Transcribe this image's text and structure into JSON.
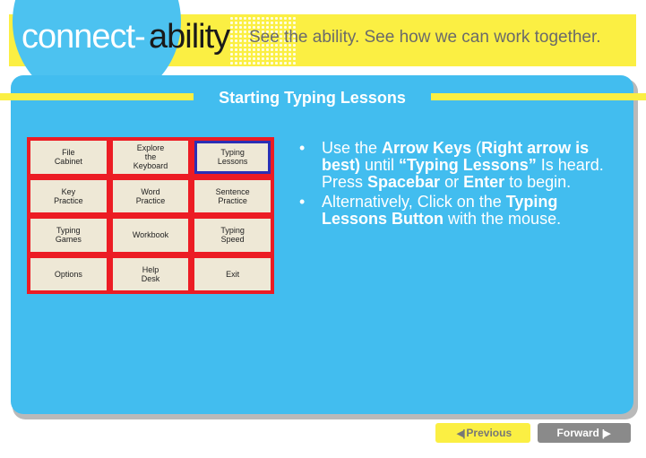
{
  "header": {
    "brand_part1": "connect-",
    "brand_part2": "ability",
    "tagline": "See the ability. See how we can work together."
  },
  "slide": {
    "title": "Starting Typing Lessons"
  },
  "menu": {
    "selected_index": 2,
    "items": [
      {
        "label": "File\nCabinet"
      },
      {
        "label": "Explore\nthe\nKeyboard"
      },
      {
        "label": "Typing\nLessons"
      },
      {
        "label": "Key\nPractice"
      },
      {
        "label": "Word\nPractice"
      },
      {
        "label": "Sentence\nPractice"
      },
      {
        "label": "Typing\nGames"
      },
      {
        "label": "Workbook"
      },
      {
        "label": "Typing\nSpeed"
      },
      {
        "label": "Options"
      },
      {
        "label": "Help\nDesk"
      },
      {
        "label": "Exit"
      }
    ]
  },
  "instructions": {
    "bullet": "•",
    "b1": {
      "t1": "Use the ",
      "t2": "Arrow Keys",
      "t3": " (",
      "t4": "Right arrow is best)",
      "t5": " until ",
      "t6": "“Typing Lessons”",
      "t7": " Is heard.  Press ",
      "t8": "Spacebar",
      "t9": " or ",
      "t10": "Enter",
      "t11": " to begin."
    },
    "b2": {
      "t1": "Alternatively, Click on the ",
      "t2": "Typing Lessons Button",
      "t3": " with the mouse."
    }
  },
  "nav": {
    "previous_label": "Previous",
    "forward_label": "Forward"
  },
  "colors": {
    "header_yellow": "#fbef43",
    "panel_blue": "#42bdef",
    "menu_red": "#ec1c24",
    "selected_outline": "#2b2fb5"
  }
}
